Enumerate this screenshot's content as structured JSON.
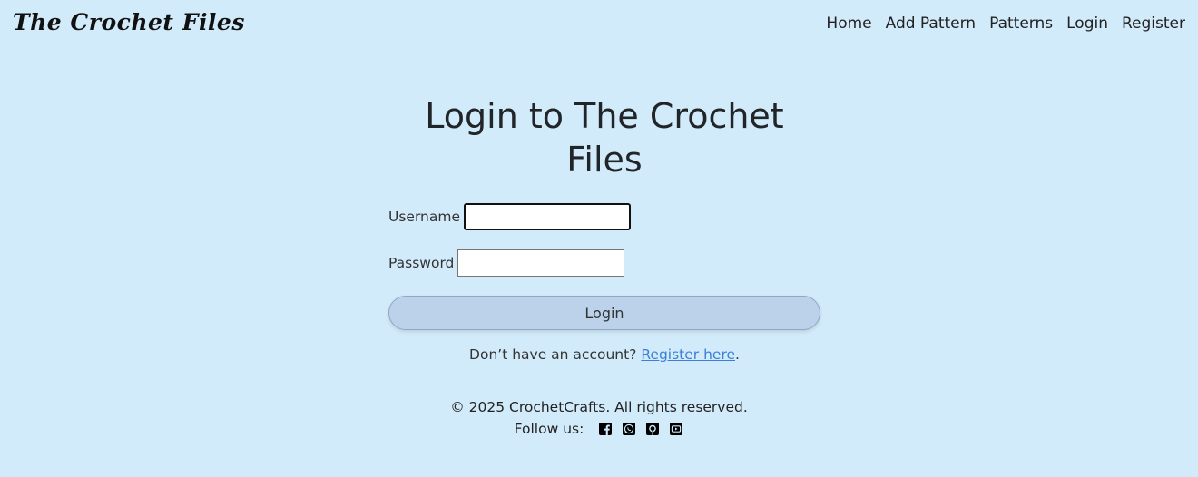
{
  "navbar": {
    "brand": "The Crochet Files",
    "links": [
      "Home",
      "Add Pattern",
      "Patterns",
      "Login",
      "Register"
    ]
  },
  "login": {
    "title": "Login to The Crochet Files",
    "username_label": "Username",
    "username_value": "",
    "password_label": "Password",
    "password_value": "",
    "submit_label": "Login",
    "register_prompt": "Don’t have an account?",
    "register_link": "Register here",
    "register_suffix": "."
  },
  "footer": {
    "copyright": "© 2025 CrochetCrafts. All rights reserved.",
    "follow_label": "Follow us:",
    "social_icons": [
      "facebook-icon",
      "whatsapp-icon",
      "github-icon",
      "youtube-icon"
    ]
  },
  "colors": {
    "background": "#d2ebfa",
    "button": "#bbd2ea",
    "link": "#3b7fd6"
  }
}
